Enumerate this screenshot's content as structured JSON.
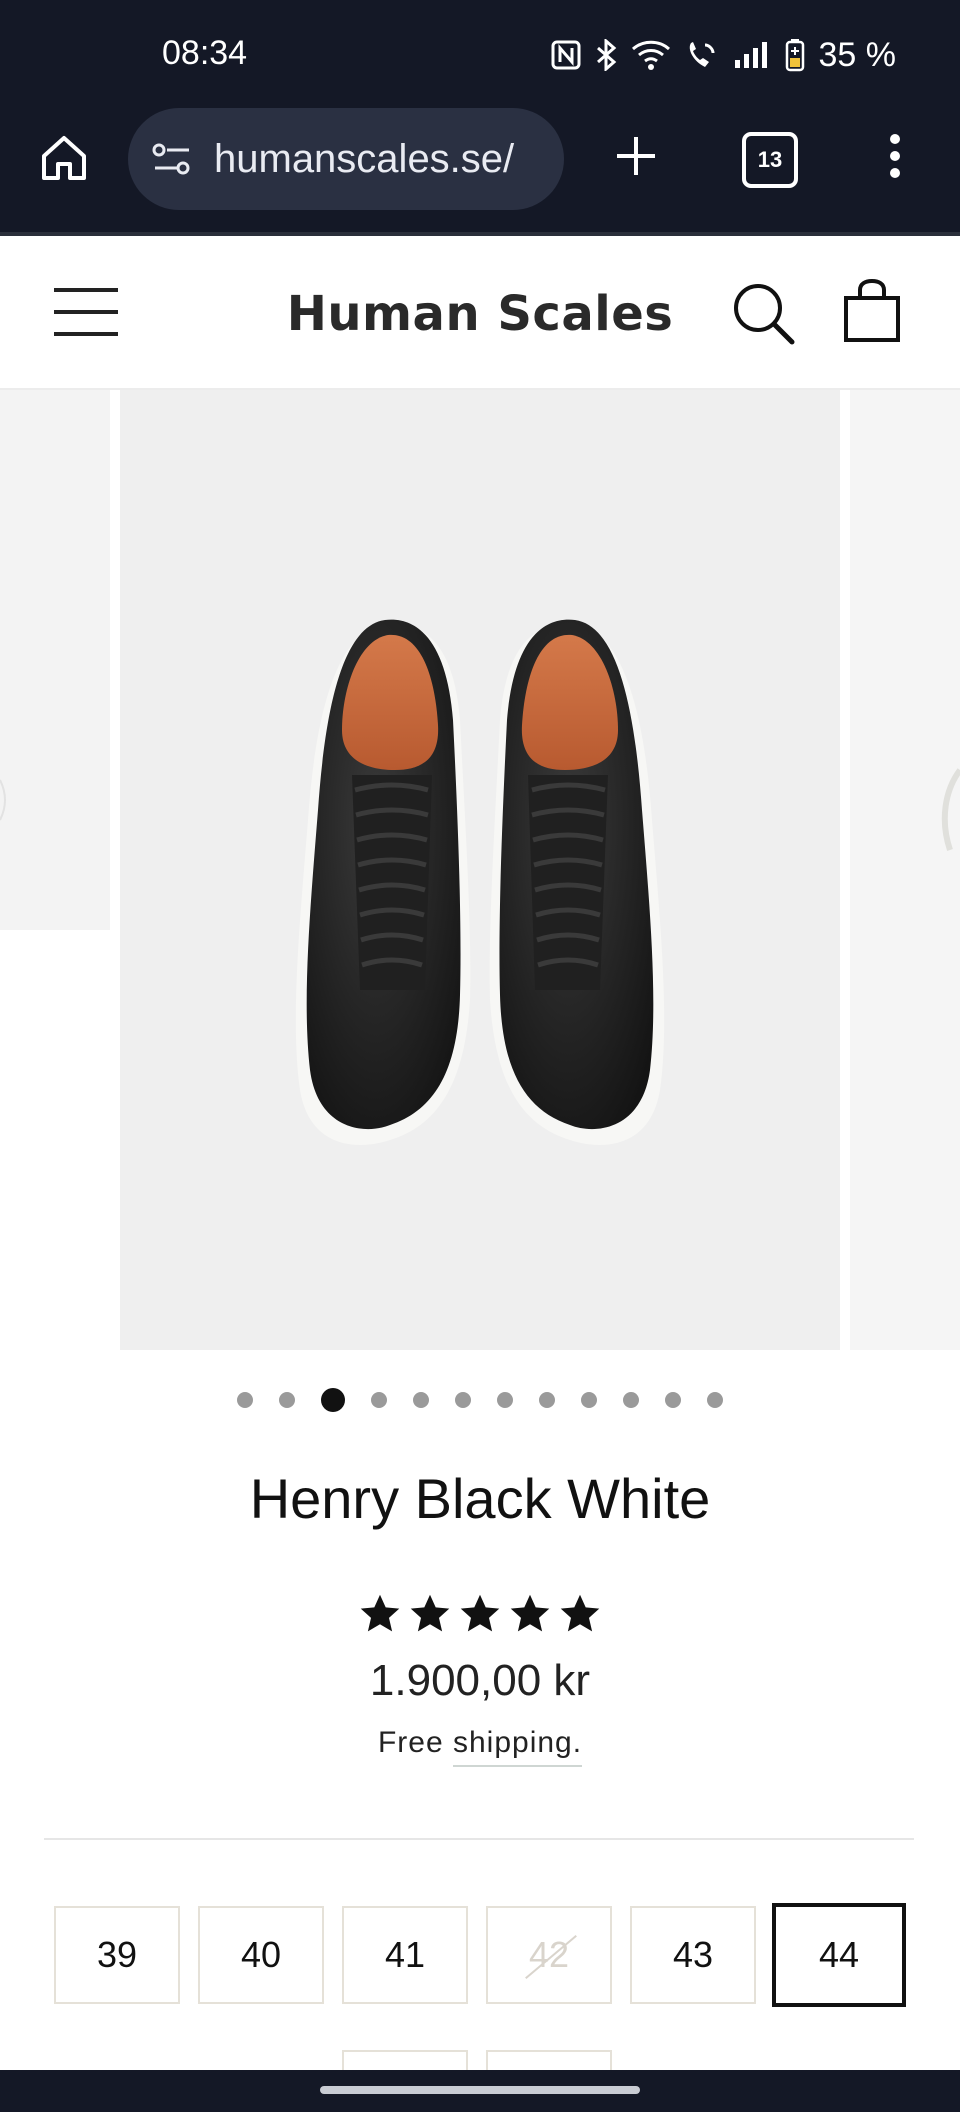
{
  "status_bar": {
    "time": "08:34",
    "battery": "35 %",
    "icons": [
      "nfc-icon",
      "bluetooth-icon",
      "wifi-icon",
      "wifi-calling-icon",
      "signal-icon",
      "battery-icon"
    ]
  },
  "browser": {
    "url": "humanscales.se/",
    "tab_count": "13"
  },
  "header": {
    "brand": "Human Scales"
  },
  "carousel": {
    "slide_count": 12,
    "active_index": 2
  },
  "product": {
    "title": "Henry Black White",
    "rating": 5,
    "price": "1.900,00 kr",
    "shipping_prefix": "Free ",
    "shipping_link": "shipping."
  },
  "sizes": [
    {
      "label": "39",
      "available": true,
      "selected": false
    },
    {
      "label": "40",
      "available": true,
      "selected": false
    },
    {
      "label": "41",
      "available": true,
      "selected": false
    },
    {
      "label": "42",
      "available": false,
      "selected": false
    },
    {
      "label": "43",
      "available": true,
      "selected": false
    },
    {
      "label": "44",
      "available": true,
      "selected": true
    }
  ],
  "colors": {
    "browser_bg": "#141826",
    "url_pill": "#2a3042",
    "leather_black": "#1c1c1c",
    "lining_orange": "#c46a3f",
    "sole_white": "#f7f7f5"
  }
}
